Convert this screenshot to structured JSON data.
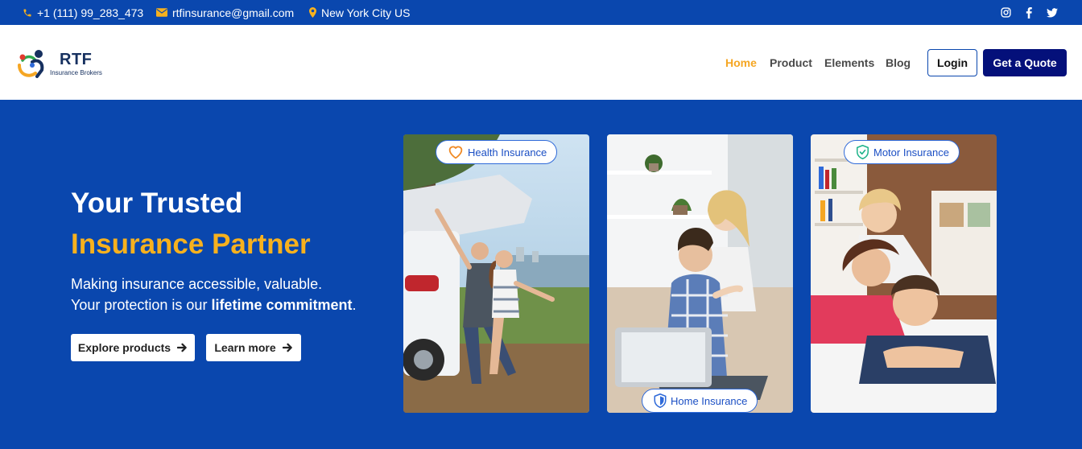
{
  "topbar": {
    "phone": "+1 (111) 99_283_473",
    "email": "rtfinsurance@gmail.com",
    "location": "New York City US",
    "social_icons": [
      "instagram-icon",
      "facebook-icon",
      "twitter-icon"
    ]
  },
  "logo": {
    "name": "RTF",
    "tagline": "Insurance Brokers"
  },
  "nav": {
    "items": [
      "Home",
      "Product",
      "Elements",
      "Blog"
    ],
    "active": "Home",
    "login": "Login",
    "quote": "Get a Quote"
  },
  "hero": {
    "title_line1": "Your Trusted",
    "title_line2": "Insurance Partner",
    "desc_line1": "Making insurance accessible, valuable.",
    "desc_line2_prefix": "Your protection is our ",
    "desc_line2_bold": "lifetime commitment",
    "desc_line2_suffix": ".",
    "btn_explore": "Explore products",
    "btn_learn": "Learn more"
  },
  "cards": [
    {
      "badge": "Health Insurance",
      "icon": "heart-icon"
    },
    {
      "badge": "Home Insurance",
      "icon": "shield-icon"
    },
    {
      "badge": "Motor Insurance",
      "icon": "shield-check-icon"
    }
  ],
  "colors": {
    "primary": "#0a47ae",
    "accent": "#f7b11e",
    "dark_button": "#04107a",
    "nav_active": "#f5a623"
  }
}
